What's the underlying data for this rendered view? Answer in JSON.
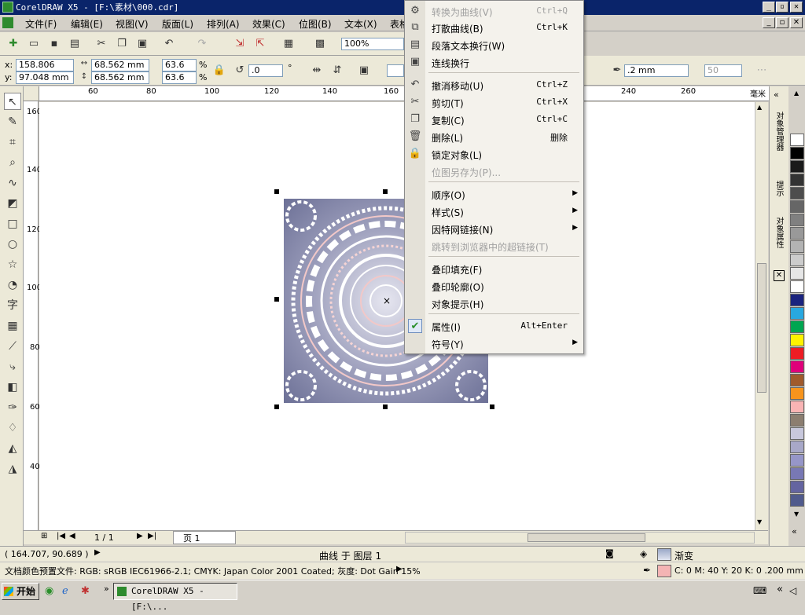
{
  "window": {
    "title": "CorelDRAW X5 - [F:\\素材\\000.cdr]"
  },
  "menubar": [
    {
      "label": "文件(F)"
    },
    {
      "label": "编辑(E)"
    },
    {
      "label": "视图(V)"
    },
    {
      "label": "版面(L)"
    },
    {
      "label": "排列(A)"
    },
    {
      "label": "效果(C)"
    },
    {
      "label": "位图(B)"
    },
    {
      "label": "文本(X)"
    },
    {
      "label": "表格"
    }
  ],
  "toolbar": {
    "zoom": "100%"
  },
  "propbar": {
    "x_label": "x:",
    "x": "158.806 mm",
    "y_label": "y:",
    "y": "97.048 mm",
    "width": "68.562 mm",
    "height": "68.562 mm",
    "scale_x": "63.6",
    "scale_y": "63.6",
    "percent": "%",
    "rotation": ".0",
    "degree": "°",
    "outline_width": ".2 mm",
    "smoothing": "50"
  },
  "rulers": {
    "horizontal": [
      "60",
      "80",
      "100",
      "120",
      "140",
      "160",
      "240",
      "260"
    ],
    "vertical": [
      "160",
      "140",
      "120",
      "100",
      "80",
      "60",
      "40"
    ],
    "unit": "毫米"
  },
  "pagenav": {
    "count": "1 / 1",
    "tab": "页 1"
  },
  "context_menu": [
    {
      "label": "转换为曲线(V)",
      "shortcut": "Ctrl+Q",
      "disabled": true,
      "icon": "convert-curve-icon"
    },
    {
      "label": "打散曲线(B)",
      "shortcut": "Ctrl+K",
      "icon": "break-apart-icon"
    },
    {
      "label": "段落文本换行(W)",
      "shortcut": "",
      "icon": "wrap-text-icon"
    },
    {
      "label": "连线换行",
      "shortcut": "",
      "icon": "connector-wrap-icon"
    },
    {
      "label": "撤消移动(U)",
      "shortcut": "Ctrl+Z",
      "icon": "undo-icon"
    },
    {
      "label": "剪切(T)",
      "shortcut": "Ctrl+X",
      "icon": "scissors-icon"
    },
    {
      "label": "复制(C)",
      "shortcut": "Ctrl+C",
      "icon": "copy-icon"
    },
    {
      "label": "删除(L)",
      "shortcut": "删除",
      "icon": "trash-icon"
    },
    {
      "label": "锁定对象(L)",
      "shortcut": "",
      "icon": "lock-icon"
    },
    {
      "label": "位图另存为(P)...",
      "shortcut": "",
      "disabled": true
    },
    {
      "label": "顺序(O)",
      "submenu": true
    },
    {
      "label": "样式(S)",
      "submenu": true
    },
    {
      "label": "因特网链接(N)",
      "submenu": true
    },
    {
      "label": "跳转到浏览器中的超链接(T)",
      "disabled": true
    },
    {
      "label": "叠印填充(F)"
    },
    {
      "label": "叠印轮廓(O)"
    },
    {
      "label": "对象提示(H)"
    },
    {
      "label": "属性(I)",
      "shortcut": "Alt+Enter",
      "checked": true,
      "icon": "check-icon"
    },
    {
      "label": "符号(Y)",
      "submenu": true
    }
  ],
  "dockers": {
    "tab1": "对象管理器",
    "tab2": "提示",
    "tab3": "对象属性"
  },
  "status": {
    "coords": "( 164.707, 90.689 )",
    "object": "曲线 于 图层 1",
    "fill_name": "渐变",
    "doc_profile": "文档颜色预置文件: RGB: sRGB IEC61966-2.1; CMYK: Japan Color 2001 Coated; 灰度: Dot Gain 15%",
    "outline": "C: 0 M: 40 Y: 20 K: 0  .200 mm"
  },
  "taskbar": {
    "start": "开始",
    "task": "CorelDRAW X5 - [F:\\..."
  },
  "palette": [
    "#ffffff",
    "#000000",
    "#1a1a1a",
    "#333333",
    "#4d4d4d",
    "#666666",
    "#808080",
    "#999999",
    "#b3b3b3",
    "#cccccc",
    "#e6e6e6",
    "#ffffff",
    "#1a237e",
    "#29a8e0",
    "#00a651",
    "#fff200",
    "#ed1c24",
    "#e0007a",
    "#a05a2c",
    "#f7941d",
    "#f9b4b4",
    "#8c7e70",
    "#c8c8dc",
    "#a8a8c8",
    "#9696c8",
    "#7878b4",
    "#6464a0",
    "#505a8c"
  ],
  "colors": {
    "accent": "#0a246a",
    "selection": "#316ac5"
  }
}
